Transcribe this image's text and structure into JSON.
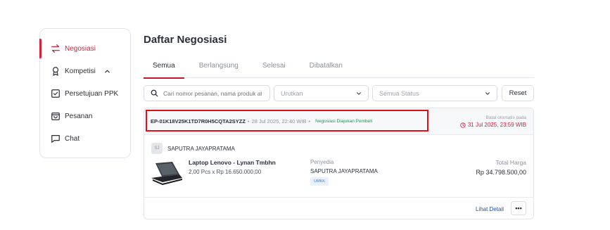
{
  "sidebar": {
    "items": [
      {
        "label": "Negosiasi",
        "icon": "arrows-exchange-icon"
      },
      {
        "label": "Kompetisi",
        "icon": "award-ribbon-icon"
      },
      {
        "label": "Persetujuan PPK",
        "icon": "checkbox-icon"
      },
      {
        "label": "Pesanan",
        "icon": "shopping-bag-icon"
      },
      {
        "label": "Chat",
        "icon": "chat-bubble-icon"
      }
    ],
    "active_color": "#d1213f"
  },
  "page": {
    "title": "Daftar Negosiasi"
  },
  "tabs": [
    {
      "label": "Semua",
      "active": true
    },
    {
      "label": "Berlangsung",
      "active": false
    },
    {
      "label": "Selesai",
      "active": false
    },
    {
      "label": "Dibatalkan",
      "active": false
    }
  ],
  "filters": {
    "search_placeholder": "Cari nomor pesanan, nama produk atau penyedia",
    "sort_placeholder": "Urutkan",
    "status_placeholder": "Semua Status",
    "reset_label": "Reset"
  },
  "order": {
    "id": "EP-01K18V25K1TD7R0H5CQTA2SYZZ",
    "separator": "•",
    "date": "28 Jul 2025, 22:40 WIB",
    "status": "Negosiasi Diajukan Pembeli",
    "status_color": "#1a9a4b",
    "cancel_label": "Batal otomatis pada",
    "cancel_time": "31 Jul 2025, 23:59 WIB",
    "seller_initials": "SJ",
    "seller_name": "SAPUTRA JAYAPRATAMA",
    "product_name": "Laptop Lenovo - Lynan Tmbhn",
    "product_qty": "2,00 Pcs x Rp 16.650.000,00",
    "provider_label": "Penyedia",
    "provider_name": "SAPUTRA JAYAPRATAMA",
    "provider_badge": "UMKK",
    "total_label": "Total Harga",
    "total_value": "Rp 34.798.500,00",
    "detail_link": "Lihat Detail",
    "more_label": "•••"
  }
}
